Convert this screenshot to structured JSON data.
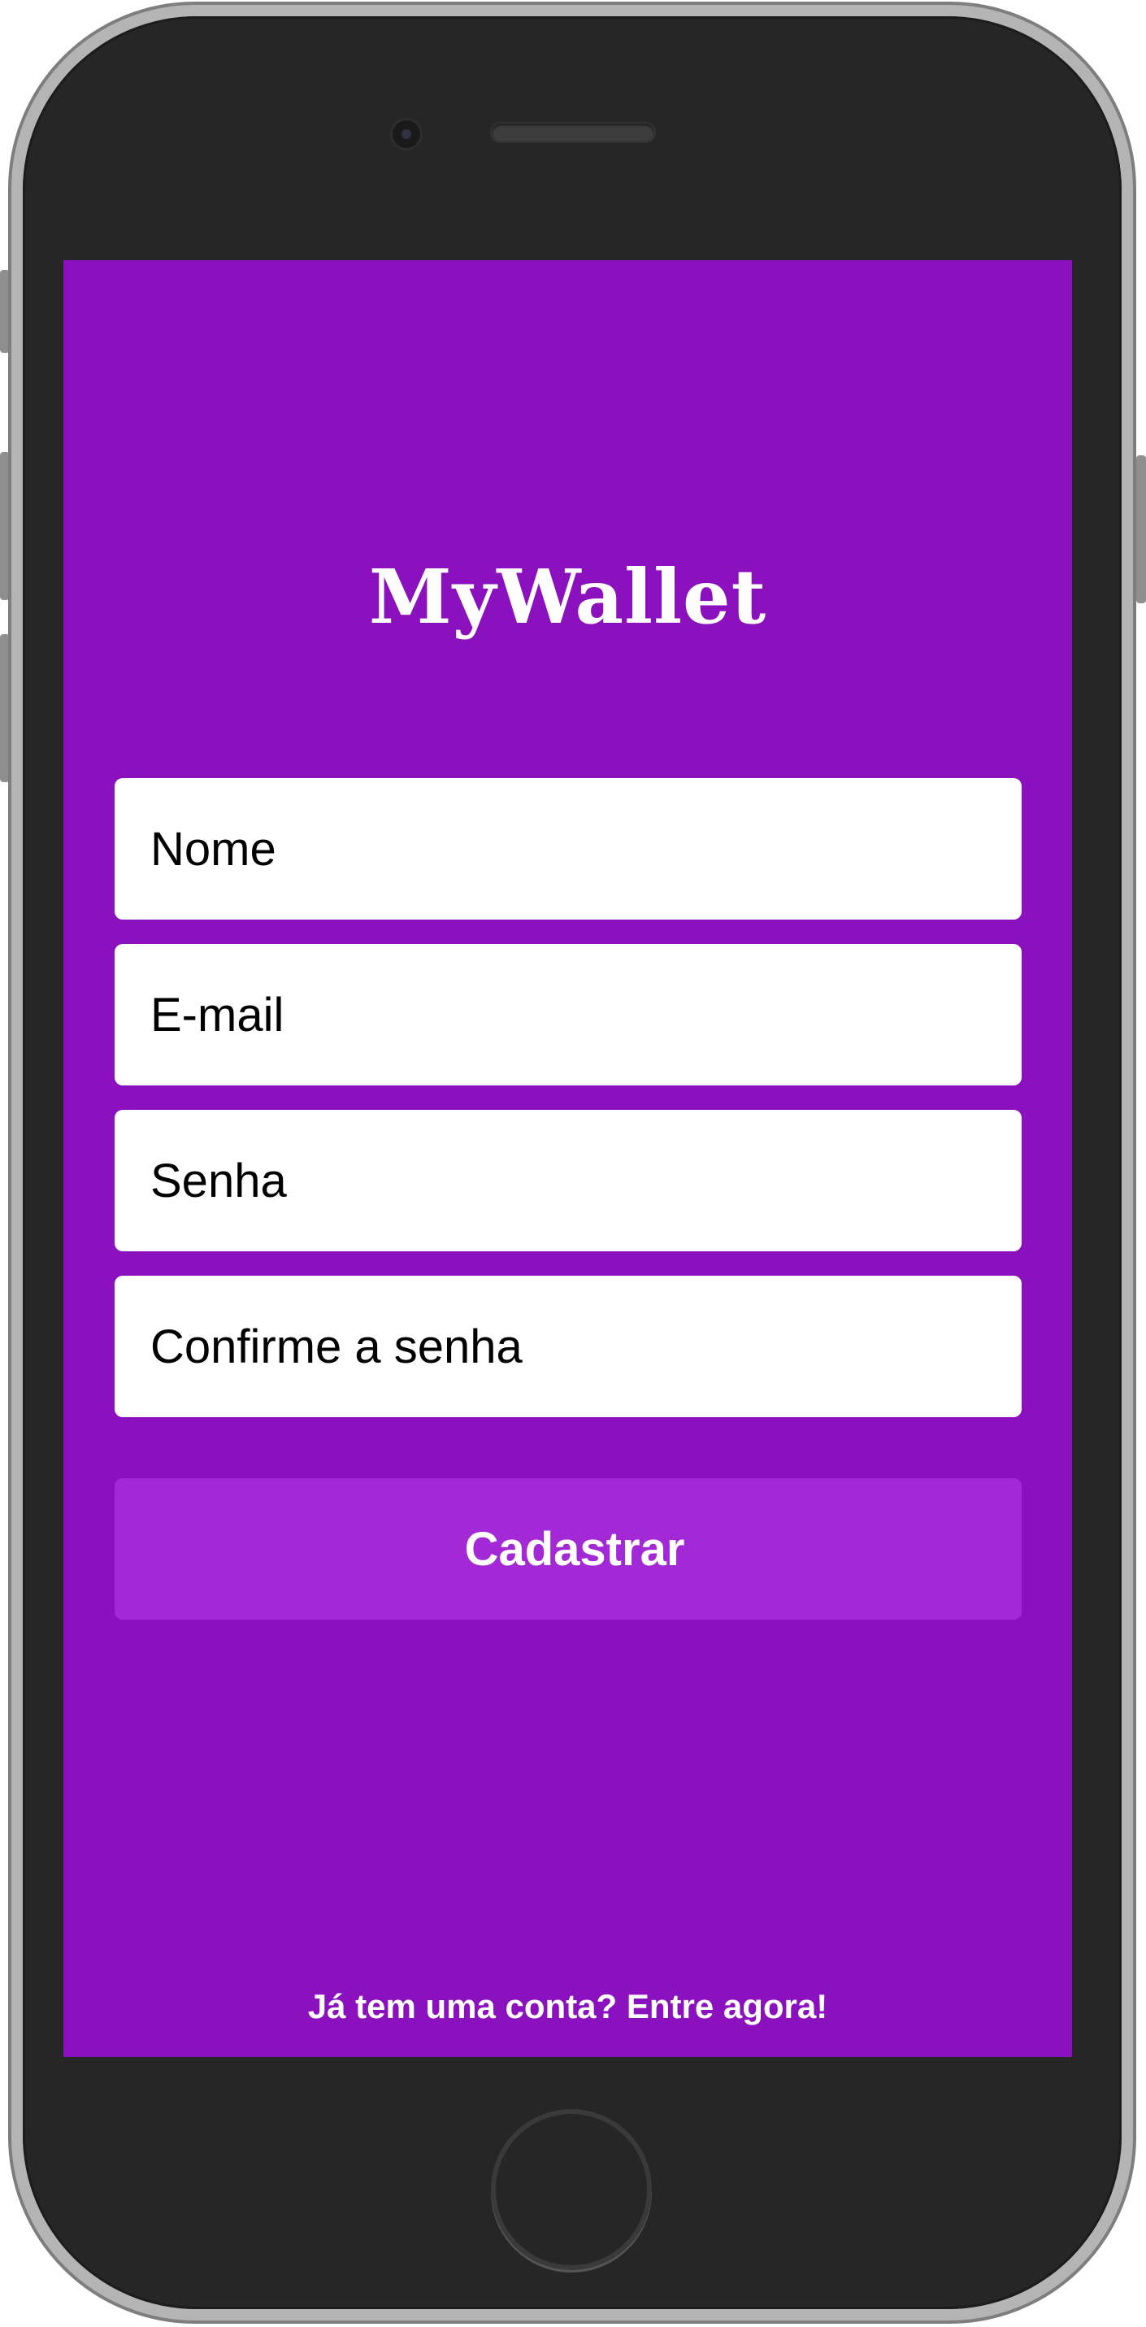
{
  "app": {
    "logo": "MyWallet"
  },
  "form": {
    "fields": [
      {
        "placeholder": "Nome",
        "value": ""
      },
      {
        "placeholder": "E-mail",
        "value": ""
      },
      {
        "placeholder": "Senha",
        "value": ""
      },
      {
        "placeholder": "Confirme a senha",
        "value": ""
      }
    ],
    "submit_label": "Cadastrar"
  },
  "login_link": "Já tem uma conta? Entre agora!",
  "colors": {
    "background": "#8c11be",
    "button": "#a328d6",
    "field_background": "#ffffff",
    "text_light": "#ffffff"
  },
  "icons": [
    "front-camera-icon",
    "earpiece-speaker-icon",
    "home-button-icon"
  ]
}
